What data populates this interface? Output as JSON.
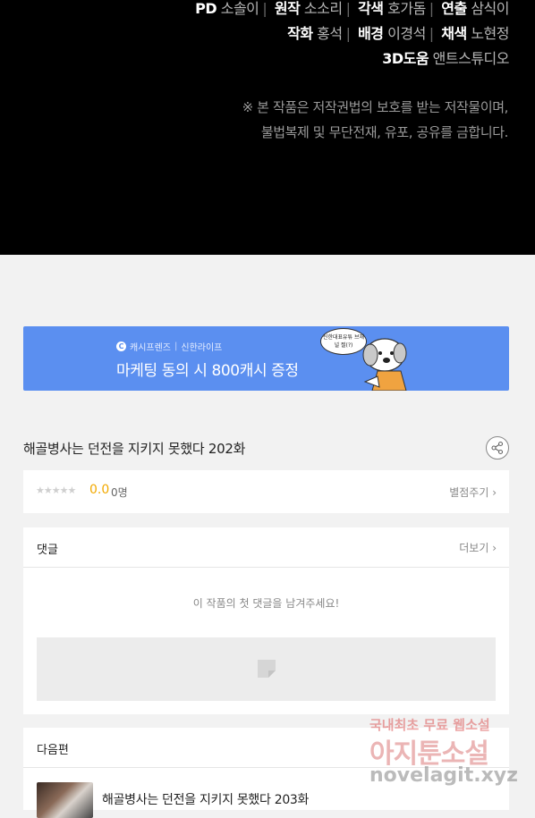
{
  "credits": {
    "line1": {
      "role1": "PD",
      "name1": "소솔이",
      "role2": "원작",
      "name2": "소소리",
      "role3": "각색",
      "name3": "호가돔",
      "role4": "연출",
      "name4": "삼식이"
    },
    "line2": {
      "role1": "작화",
      "name1": "홍석",
      "role2": "배경",
      "name2": "이경석",
      "role3": "채색",
      "name3": "노현정"
    },
    "line3": {
      "role1": "3D도움",
      "name1": "앤트스튜디오"
    },
    "notice_line1": "※ 본 작품은 저작권법의 보호를 받는 저작물이며,",
    "notice_line2": "불법복제 및 무단전재, 유포, 공유를 금합니다."
  },
  "banner": {
    "brand1": "캐시프렌즈",
    "brand2": "신한라이프",
    "promo": "마케팅 동의 시 800캐시 증정",
    "bubble": "신한대표유튜 브채널 찔(?)"
  },
  "episode": {
    "title": "해골병사는 던전을 지키지 못했다 202화"
  },
  "rating": {
    "stars": "★★★★★",
    "score": "0.0",
    "count": "0명",
    "rate_label": "별점주기 ›"
  },
  "comments": {
    "header": "댓글",
    "more": "더보기 ›",
    "empty": "이 작품의 첫 댓글을 남겨주세요!"
  },
  "next": {
    "header": "다음편",
    "title": "해골병사는 던전을 지키지 못했다 203화"
  },
  "watermark": {
    "line1a": "국내최초 무료",
    "line1b": "웹소설",
    "line2": "아지툰소설",
    "line3": "novelagit.xyz"
  },
  "colors": {
    "banner_bg": "#5b8ff0",
    "score": "#f2a900"
  }
}
